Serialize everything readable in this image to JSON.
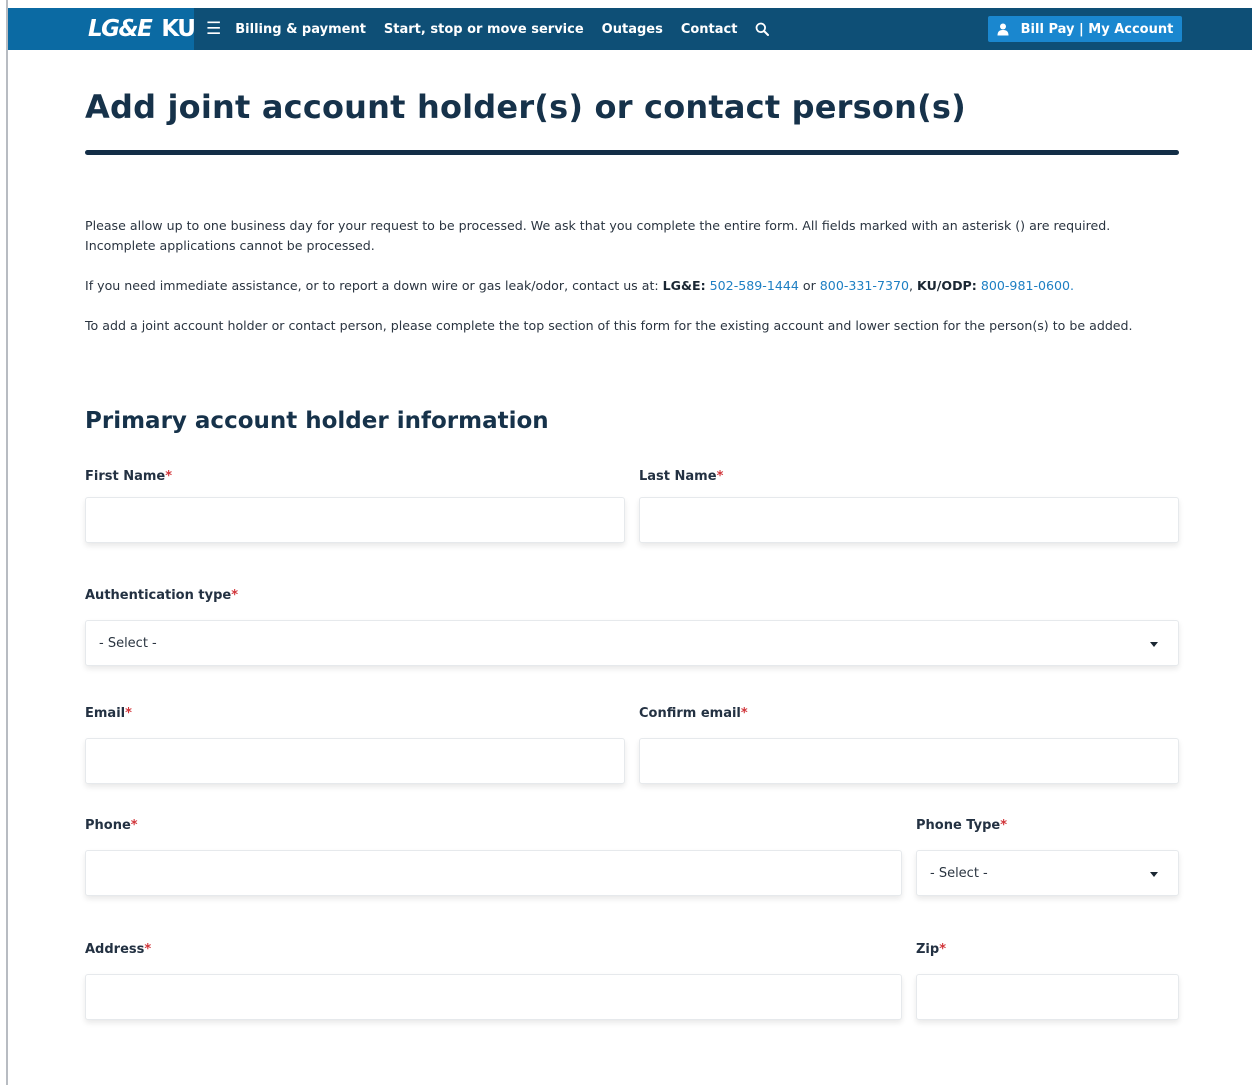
{
  "nav": {
    "logo_lge": "LG&E",
    "logo_ku": "KU",
    "menu_icon": "hamburger-icon",
    "links": [
      "Billing & payment",
      "Start, stop or move service",
      "Outages",
      "Contact"
    ],
    "search_icon": "search-icon",
    "account_label": "Bill Pay | My Account",
    "account_icon": "user-icon"
  },
  "page": {
    "title": "Add joint account holder(s) or contact person(s)",
    "intro": "Please allow up to one business day for your request to be processed. We ask that you complete the entire form. All fields marked with an asterisk () are required. Incomplete applications cannot be processed.",
    "assist_prefix": "If you need immediate assistance, or to report a down wire or gas leak/odor, contact us at: ",
    "lge_label": "LG&E:",
    "lge_phone1": "502-589-1444",
    "or": "or",
    "lge_phone2": "800-331-7370",
    "ku_label": "KU/ODP:",
    "ku_phone": "800-981-0600.",
    "instructions": "To add a joint account holder or contact person, please complete the top section of this form for the existing account and lower section for the person(s) to be added."
  },
  "form": {
    "section_title": "Primary account holder information",
    "required_mark": "*",
    "first_name": {
      "label": "First Name",
      "value": ""
    },
    "last_name": {
      "label": "Last Name",
      "value": ""
    },
    "auth_type": {
      "label": "Authentication type",
      "selected": "- Select -"
    },
    "email": {
      "label": "Email",
      "value": ""
    },
    "confirm_email": {
      "label": "Confirm email",
      "value": ""
    },
    "phone": {
      "label": "Phone",
      "value": ""
    },
    "phone_type": {
      "label": "Phone Type",
      "selected": "- Select -"
    },
    "address": {
      "label": "Address",
      "value": ""
    },
    "zip": {
      "label": "Zip",
      "value": ""
    }
  },
  "colors": {
    "nav_bg": "#0e4f76",
    "logo_bg": "#0b6aa3",
    "account_button": "#1a87cf",
    "heading": "#16324a",
    "link": "#1d7fc3",
    "required": "#d1353a"
  }
}
